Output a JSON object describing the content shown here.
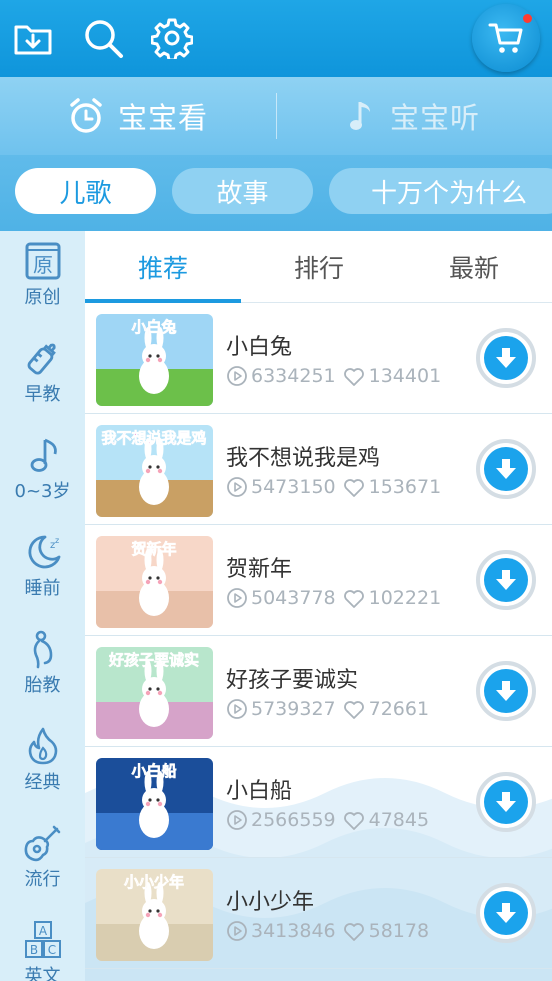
{
  "header": {
    "icons": [
      "download-folder-icon",
      "search-icon",
      "settings-gear-icon",
      "shopping-cart-icon"
    ],
    "brand_color": "#0f95db",
    "cart_has_notification": true
  },
  "modes": [
    {
      "label": "宝宝看",
      "icon": "alarm-clock-icon",
      "active": true
    },
    {
      "label": "宝宝听",
      "icon": "music-note-icon",
      "active": false
    }
  ],
  "categories": [
    {
      "label": "儿歌",
      "active": true
    },
    {
      "label": "故事",
      "active": false
    },
    {
      "label": "十万个为什么",
      "active": false
    }
  ],
  "sidebar": {
    "items": [
      {
        "label": "原创",
        "glyph": "原",
        "icon": "original-book-icon"
      },
      {
        "label": "早教",
        "icon": "baby-bottle-icon"
      },
      {
        "label": "0~3岁",
        "icon": "music-note-icon"
      },
      {
        "label": "睡前",
        "icon": "moon-sleep-icon"
      },
      {
        "label": "胎教",
        "icon": "pregnancy-icon"
      },
      {
        "label": "经典",
        "icon": "flame-icon"
      },
      {
        "label": "流行",
        "icon": "guitar-icon"
      },
      {
        "label": "英文",
        "icon": "abc-blocks-icon",
        "glyphs": [
          "A",
          "B",
          "C"
        ]
      }
    ]
  },
  "subtabs": [
    {
      "label": "推荐",
      "active": true
    },
    {
      "label": "排行",
      "active": false
    },
    {
      "label": "最新",
      "active": false
    }
  ],
  "songs": [
    {
      "title": "小白兔",
      "plays": "6334251",
      "likes": "134401",
      "thumb_text": "小白兔",
      "thumb_colors": [
        "#9fd6f5",
        "#6cc04a"
      ],
      "thumb_text_color": "#e8487c"
    },
    {
      "title": "我不想说我是鸡",
      "plays": "5473150",
      "likes": "153671",
      "thumb_text": "我不想说我是鸡",
      "thumb_colors": [
        "#b6e3f7",
        "#c9a064"
      ],
      "thumb_text_color": "#d94fb6"
    },
    {
      "title": "贺新年",
      "plays": "5043778",
      "likes": "102221",
      "thumb_text": "贺新年",
      "thumb_colors": [
        "#f7d7c8",
        "#e8c0a9"
      ],
      "thumb_text_color": "#ffffff"
    },
    {
      "title": "好孩子要诚实",
      "plays": "5739327",
      "likes": "72661",
      "thumb_text": "好孩子要诚实",
      "thumb_colors": [
        "#b8e6cc",
        "#d6a3c9"
      ],
      "thumb_text_color": "#e04aa0"
    },
    {
      "title": "小白船",
      "plays": "2566559",
      "likes": "47845",
      "thumb_text": "小白船",
      "thumb_colors": [
        "#1b4e9a",
        "#3a7ad0"
      ],
      "thumb_text_color": "#ffdd33"
    },
    {
      "title": "小小少年",
      "plays": "3413846",
      "likes": "58178",
      "thumb_text": "小小少年",
      "thumb_colors": [
        "#e9dfc8",
        "#d9cdb0"
      ],
      "thumb_text_color": "#ff9b1f"
    }
  ]
}
